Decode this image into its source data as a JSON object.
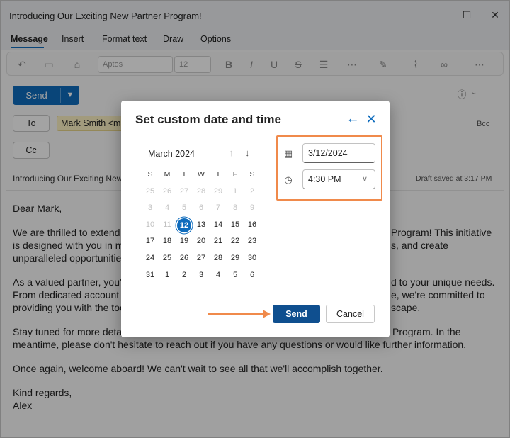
{
  "window": {
    "title": "Introducing Our Exciting New Partner Program!",
    "minimize_glyph": "—",
    "maximize_glyph": "☐",
    "close_glyph": "✕"
  },
  "ribbon": {
    "tabs": [
      {
        "label": "Message",
        "active": true
      },
      {
        "label": "Insert"
      },
      {
        "label": "Format text"
      },
      {
        "label": "Draw"
      },
      {
        "label": "Options"
      }
    ],
    "font_name": "Aptos",
    "font_size": "12"
  },
  "compose": {
    "send_label": "Send",
    "to_label": "To",
    "cc_label": "Cc",
    "bcc_label": "Bcc",
    "recipient": "Mark Smith <ma",
    "subject": "Introducing Our Exciting New",
    "draft_status": "Draft saved at 3:17 PM"
  },
  "body_lines": [
    "Dear Mark,",
    "We are thrilled to extend a",
    "is designed with you in mi",
    "unparalleled opportunities",
    "As a valued partner, you'll",
    "From dedicated account m",
    "providing you with the too",
    "Stay tuned for more detai",
    "meantime, please don't hesitate to reach out if you have any questions or would like further information.",
    "Once again, welcome aboard! We can't wait to see all that we'll accomplish together.",
    "Kind regards,",
    "Alex"
  ],
  "body_right_fragments": [
    "Program! This initiative",
    "s, and create",
    "d to your unique needs.",
    "e, we're committed to",
    "scape.",
    "Program. In the"
  ],
  "dialog": {
    "title": "Set custom date and time",
    "calendar": {
      "month_label": "March 2024",
      "weekdays": [
        "S",
        "M",
        "T",
        "W",
        "T",
        "F",
        "S"
      ],
      "weeks": [
        [
          "25",
          "26",
          "27",
          "28",
          "29",
          "1",
          "2"
        ],
        [
          "3",
          "4",
          "5",
          "6",
          "7",
          "8",
          "9"
        ],
        [
          "10",
          "11",
          "12",
          "13",
          "14",
          "15",
          "16"
        ],
        [
          "17",
          "18",
          "19",
          "20",
          "21",
          "22",
          "23"
        ],
        [
          "24",
          "25",
          "26",
          "27",
          "28",
          "29",
          "30"
        ],
        [
          "31",
          "1",
          "2",
          "3",
          "4",
          "5",
          "6"
        ]
      ],
      "selected_day": "12"
    },
    "date_value": "3/12/2024",
    "time_value": "4:30 PM",
    "send_label": "Send",
    "cancel_label": "Cancel",
    "highlight_color": "#f08a4b",
    "accent_color": "#0f6cbd"
  }
}
